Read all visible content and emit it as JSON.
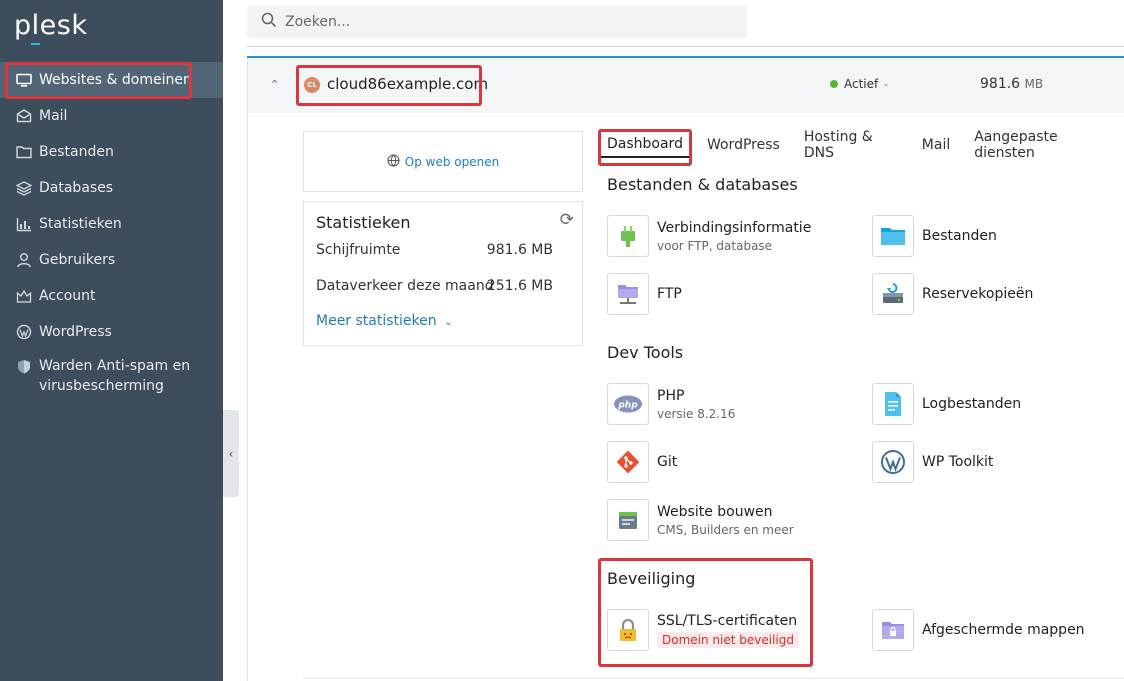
{
  "brand": {
    "logo_text": "plesk",
    "accent": "#34b4e4"
  },
  "sidebar": {
    "items": [
      {
        "label": "Websites & domeinen",
        "icon": "monitor-icon",
        "active": true
      },
      {
        "label": "Mail",
        "icon": "mail-icon"
      },
      {
        "label": "Bestanden",
        "icon": "folder-icon"
      },
      {
        "label": "Databases",
        "icon": "database-icon"
      },
      {
        "label": "Statistieken",
        "icon": "chart-icon"
      },
      {
        "label": "Gebruikers",
        "icon": "user-icon"
      },
      {
        "label": "Account",
        "icon": "account-icon"
      },
      {
        "label": "WordPress",
        "icon": "wordpress-icon"
      },
      {
        "label": "Warden Anti-spam en virusbescherming",
        "icon": "shield-icon"
      }
    ]
  },
  "search": {
    "placeholder": "Zoeken..."
  },
  "domain": {
    "badge": "CL",
    "name": "cloud86example.com",
    "status": "Actief",
    "size_value": "981.6",
    "size_unit": "MB"
  },
  "open_web": {
    "label": "Op web openen"
  },
  "stats": {
    "title": "Statistieken",
    "rows": [
      {
        "label": "Schijfruimte",
        "value": "981.6 MB"
      },
      {
        "label": "Dataverkeer deze maand",
        "value": "251.6 MB"
      }
    ],
    "more": "Meer statistieken"
  },
  "tabs": [
    "Dashboard",
    "WordPress",
    "Hosting & DNS",
    "Mail",
    "Aangepaste diensten"
  ],
  "sections": {
    "files": {
      "title": "Bestanden & databases",
      "tools": [
        {
          "name": "Verbindingsinformatie",
          "sub": "voor FTP, database",
          "icon": "plug-icon"
        },
        {
          "name": "Bestanden",
          "icon": "folder-icon"
        },
        {
          "name": "FTP",
          "icon": "ftp-folder-icon"
        },
        {
          "name": "Reservekopieën",
          "icon": "backup-icon"
        }
      ]
    },
    "dev": {
      "title": "Dev Tools",
      "tools": [
        {
          "name": "PHP",
          "sub": "versie 8.2.16",
          "icon": "php-icon"
        },
        {
          "name": "Logbestanden",
          "icon": "log-file-icon"
        },
        {
          "name": "Git",
          "icon": "git-icon"
        },
        {
          "name": "WP Toolkit",
          "icon": "wordpress-icon"
        },
        {
          "name": "Website bouwen",
          "sub": "CMS, Builders en meer",
          "icon": "site-builder-icon"
        }
      ]
    },
    "security": {
      "title": "Beveiliging",
      "tools": [
        {
          "name": "SSL/TLS-certificaten",
          "badge": "Domein niet beveiligd",
          "icon": "lock-icon"
        },
        {
          "name": "Afgeschermde mappen",
          "icon": "protected-folder-icon"
        }
      ]
    }
  },
  "colors": {
    "sidebar": "#3d4d5c",
    "highlight": "#d9363e",
    "link": "#1e7bc4",
    "status_ok": "#57b33a"
  }
}
